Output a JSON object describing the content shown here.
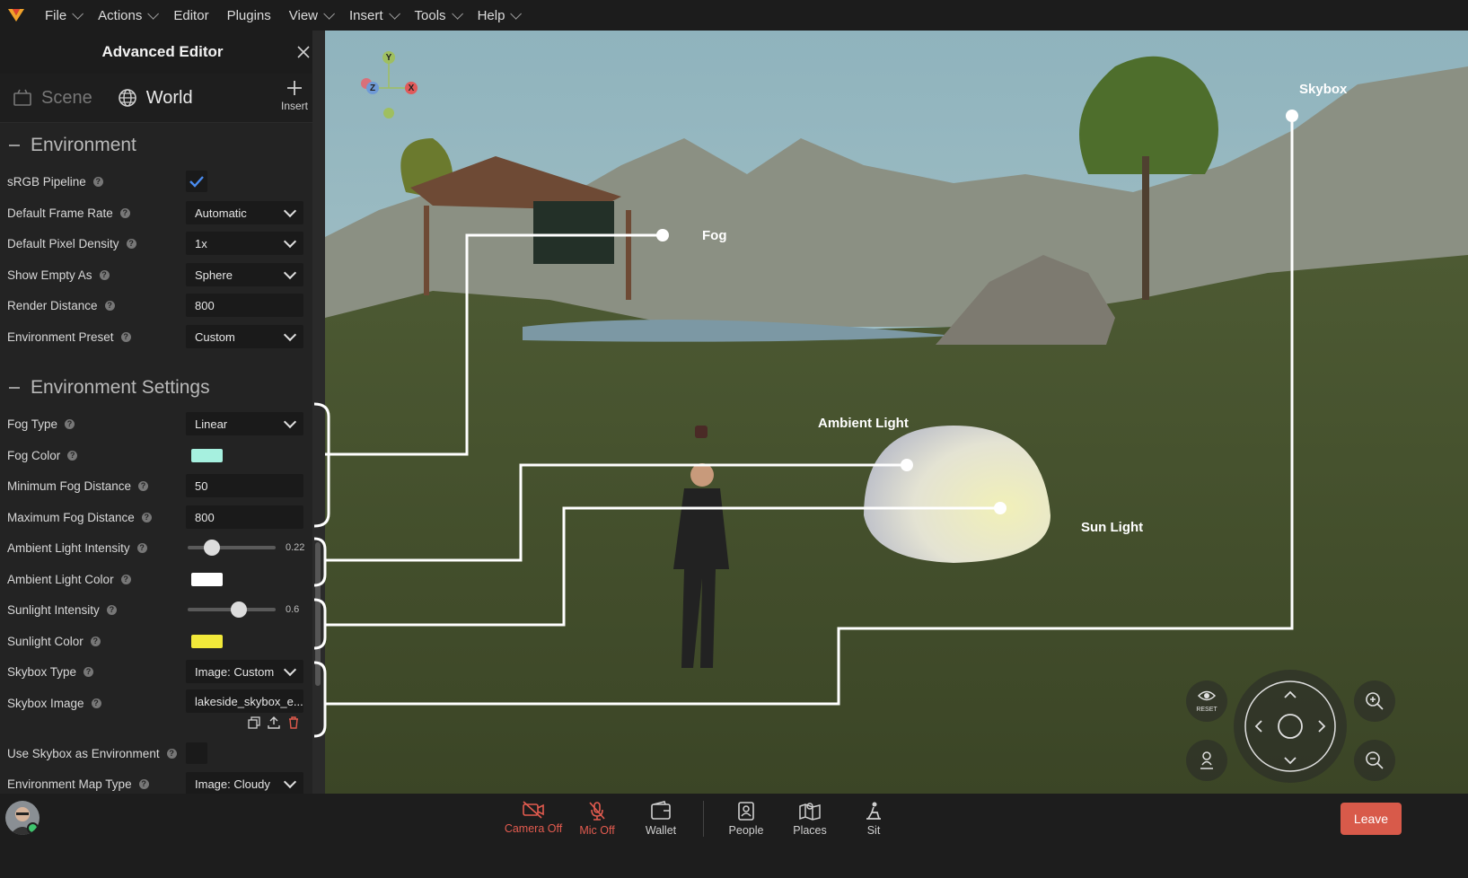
{
  "menubar": {
    "items": [
      {
        "label": "File",
        "chevron": true
      },
      {
        "label": "Actions",
        "chevron": true
      },
      {
        "label": "Editor",
        "chevron": false
      },
      {
        "label": "Plugins",
        "chevron": false
      },
      {
        "label": "View",
        "chevron": true
      },
      {
        "label": "Insert",
        "chevron": true
      },
      {
        "label": "Tools",
        "chevron": true
      },
      {
        "label": "Help",
        "chevron": true
      }
    ]
  },
  "panel": {
    "title": "Advanced Editor",
    "tabs": {
      "scene": "Scene",
      "world": "World",
      "insert": "Insert"
    },
    "environment": {
      "heading": "Environment",
      "srgb_label": "sRGB Pipeline",
      "frame_rate_label": "Default Frame Rate",
      "frame_rate_value": "Automatic",
      "pixel_density_label": "Default Pixel Density",
      "pixel_density_value": "1x",
      "show_empty_label": "Show Empty As",
      "show_empty_value": "Sphere",
      "render_distance_label": "Render Distance",
      "render_distance_value": "800",
      "preset_label": "Environment Preset",
      "preset_value": "Custom"
    },
    "settings": {
      "heading": "Environment Settings",
      "fog_type_label": "Fog Type",
      "fog_type_value": "Linear",
      "fog_color_label": "Fog Color",
      "fog_color": "#a6f0df",
      "min_fog_label": "Minimum Fog Distance",
      "min_fog_value": "50",
      "max_fog_label": "Maximum Fog Distance",
      "max_fog_value": "800",
      "ambient_intensity_label": "Ambient Light Intensity",
      "ambient_intensity_value": "0.22",
      "ambient_intensity_fraction": 0.22,
      "ambient_color_label": "Ambient Light Color",
      "ambient_color": "#ffffff",
      "sun_intensity_label": "Sunlight Intensity",
      "sun_intensity_value": "0.6",
      "sun_intensity_fraction": 0.6,
      "sun_color_label": "Sunlight Color",
      "sun_color": "#f2e93a",
      "skybox_type_label": "Skybox Type",
      "skybox_type_value": "Image: Custom",
      "skybox_image_label": "Skybox Image",
      "skybox_image_value": "lakeside_skybox_e...",
      "use_skybox_label": "Use Skybox as Environment",
      "env_map_label": "Environment Map Type",
      "env_map_value": "Image: Cloudy"
    }
  },
  "viewport": {
    "callouts": {
      "fog": "Fog",
      "skybox": "Skybox",
      "ambient": "Ambient Light",
      "sun": "Sun Light"
    },
    "gizmo": {
      "y": "Y",
      "z": "Z",
      "x": "X"
    },
    "reset_label": "RESET"
  },
  "bottombar": {
    "camera": "Camera Off",
    "mic": "Mic Off",
    "wallet": "Wallet",
    "people": "People",
    "places": "Places",
    "sit": "Sit",
    "leave": "Leave"
  }
}
